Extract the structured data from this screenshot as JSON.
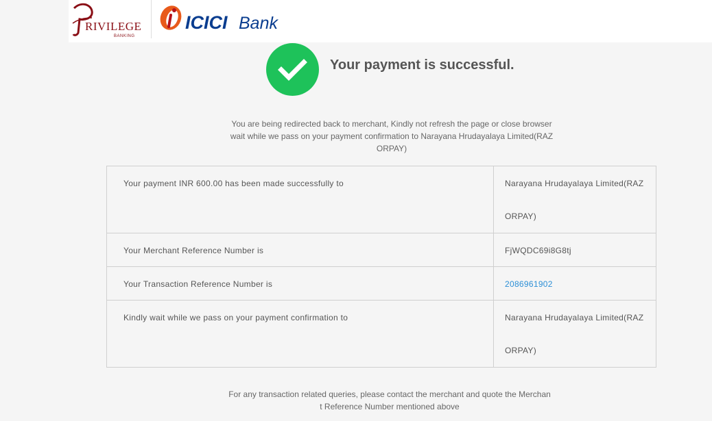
{
  "header": {
    "privilege_logo_text": "PRIVILEGE",
    "privilege_logo_sub": "BANKING",
    "bank_logo_text": "ICICI Bank"
  },
  "status": {
    "title": "Your payment is successful.",
    "redirect_message": "You are being redirected back to merchant, Kindly not refresh the page or close browser wait while we pass on your payment confirmation to Narayana Hrudayalaya Limited(RAZORPAY)"
  },
  "details": {
    "rows": [
      {
        "label": "Your payment INR 600.00 has been made successfully to",
        "value": "Narayana Hrudayalaya Limited(RAZORPAY)"
      },
      {
        "label": "Your Merchant Reference Number is",
        "value": "FjWQDC69i8G8tj"
      },
      {
        "label": "Your Transaction Reference Number is",
        "value": "2086961902"
      },
      {
        "label": "Kindly wait while we pass on your payment confirmation to",
        "value": "Narayana Hrudayalaya Limited(RAZORPAY)"
      }
    ]
  },
  "footer": {
    "message": "For any transaction related queries, please contact the merchant and quote the Merchant Reference Number mentioned above"
  },
  "colors": {
    "success_green": "#1ec25a",
    "link_blue": "#2c8fd6",
    "brand_red": "#b5121b",
    "brand_blue": "#0a3d8f"
  }
}
